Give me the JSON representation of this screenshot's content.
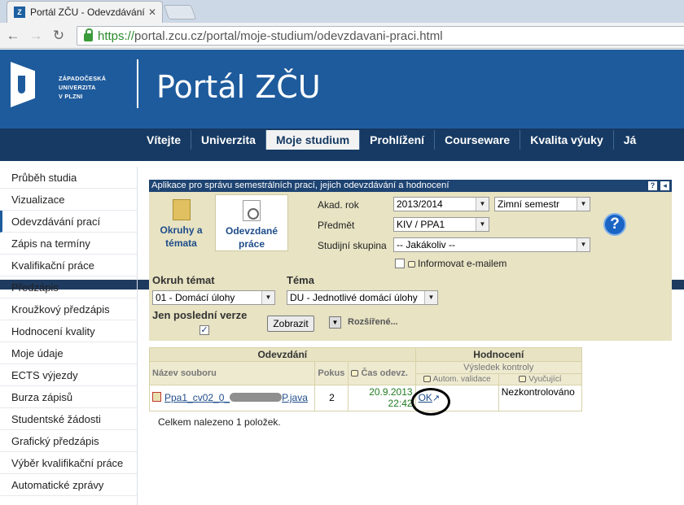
{
  "browser": {
    "tab_title": "Portál ZČU - Odevzdávání",
    "url_scheme": "https://",
    "url_rest": "portal.zcu.cz/portal/moje-studium/odevzdavani-praci.html"
  },
  "header": {
    "university_lines": [
      "ZÁPADOČESKÁ",
      "UNIVERZITA",
      "V PLZNI"
    ],
    "portal_title": "Portál ZČU"
  },
  "mainnav": [
    "Vítejte",
    "Univerzita",
    "Moje studium",
    "Prohlížení",
    "Courseware",
    "Kvalita výuky",
    "Já"
  ],
  "sidebar": [
    "Průběh studia",
    "Vizualizace",
    "Odevzdávání prací",
    "Zápis na termíny",
    "Kvalifikační práce",
    "Předzápis",
    "Kroužkový předzápis",
    "Hodnocení kvality",
    "Moje údaje",
    "ECTS výjezdy",
    "Burza zápisů",
    "Studentské žádosti",
    "Grafický předzápis",
    "Výběr kvalifikační práce",
    "Automatické zprávy"
  ],
  "app": {
    "title": "Aplikace pro správu semestrálních prací, jejich odevzdávání a hodnocení",
    "module1_lines": [
      "Okruhy a",
      "témata"
    ],
    "module2_lines": [
      "Odevzdané",
      "práce"
    ],
    "akad_rok_label": "Akad. rok",
    "akad_rok_value": "2013/2014",
    "semestr_value": "Zimní semestr",
    "predmet_label": "Předmět",
    "predmet_value": "KIV / PPA1",
    "skupina_label": "Studijní skupina",
    "skupina_value": "-- Jakákoliv --",
    "informovat_label": "Informovat e-mailem",
    "okruh_label": "Okruh témat",
    "okruh_value": "01 - Domácí úlohy",
    "tema_label": "Téma",
    "tema_value": "DU - Jednotlivé domácí úlohy",
    "posledni_label": "Jen poslední verze",
    "zobrazit_label": "Zobrazit",
    "rozsirene_label": "Rozšířené..."
  },
  "results": {
    "group_odevzdani": "Odevzdání",
    "group_hodnoceni": "Hodnocení",
    "col_nazev": "Název souboru",
    "col_pokus": "Pokus",
    "col_cas": "Čas odevz.",
    "col_vysledek": "Výsledek kontroly",
    "col_autom": "Autom. validace",
    "col_vyucujici": "Vyučující",
    "row": {
      "file_prefix": "Ppa1_cv02_0_",
      "file_suffix": "P.java",
      "pokus": "2",
      "date": "20.9.2013",
      "time": "22:42",
      "autom": "OK",
      "vyucujici": "Nezkontrolováno"
    },
    "total": "Celkem nalezeno 1 položek."
  },
  "colors": {
    "header_blue": "#1e5b9c",
    "nav_dark": "#163a63",
    "panel_tan": "#e7e3c3"
  }
}
